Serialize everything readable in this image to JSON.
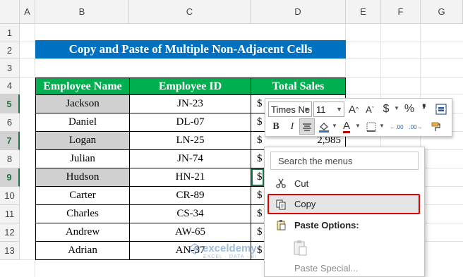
{
  "columns": [
    "A",
    "B",
    "C",
    "D",
    "E",
    "F",
    "G"
  ],
  "rows": [
    "1",
    "2",
    "3",
    "4",
    "5",
    "6",
    "7",
    "8",
    "9",
    "10",
    "11",
    "12",
    "13"
  ],
  "title": "Copy and Paste of Multiple Non-Adjacent Cells",
  "table": {
    "headers": [
      "Employee Name",
      "Employee ID",
      "Total Sales"
    ],
    "rows": [
      {
        "name": "Jackson",
        "id": "JN-23",
        "currency": "$",
        "sales": ""
      },
      {
        "name": "Daniel",
        "id": "DL-07",
        "currency": "$",
        "sales": ""
      },
      {
        "name": "Logan",
        "id": "LN-25",
        "currency": "$",
        "sales": "2,985"
      },
      {
        "name": "Julian",
        "id": "JN-74",
        "currency": "$",
        "sales": ""
      },
      {
        "name": "Hudson",
        "id": "HN-21",
        "currency": "$",
        "sales": ""
      },
      {
        "name": "Carter",
        "id": "CR-89",
        "currency": "$",
        "sales": ""
      },
      {
        "name": "Charles",
        "id": "CS-34",
        "currency": "$",
        "sales": ""
      },
      {
        "name": "Andrew",
        "id": "AW-65",
        "currency": "$",
        "sales": ""
      },
      {
        "name": "Adrian",
        "id": "AN-37",
        "currency": "$",
        "sales": ""
      }
    ]
  },
  "mini_toolbar": {
    "font_name": "Times Ne",
    "font_size": "11",
    "increase_font": "A",
    "decrease_font": "A",
    "currency": "$",
    "percent": "%",
    "comma": "❜",
    "bold": "B",
    "italic": "I",
    "font_color_glyph": "A",
    "decrease_decimal": "←.00",
    "increase_decimal": ".00→"
  },
  "context_menu": {
    "search_placeholder": "Search the menus",
    "cut": "Cut",
    "copy": "Copy",
    "paste_options": "Paste Options:",
    "paste_special": "Paste Special..."
  },
  "watermark": {
    "name": "exceldemy",
    "tagline": "EXCEL · DATA · BI"
  },
  "colors": {
    "title_bg": "#0070c0",
    "header_bg": "#00b050",
    "highlight": "#d0d0d0",
    "copy_outline": "#e00000"
  }
}
